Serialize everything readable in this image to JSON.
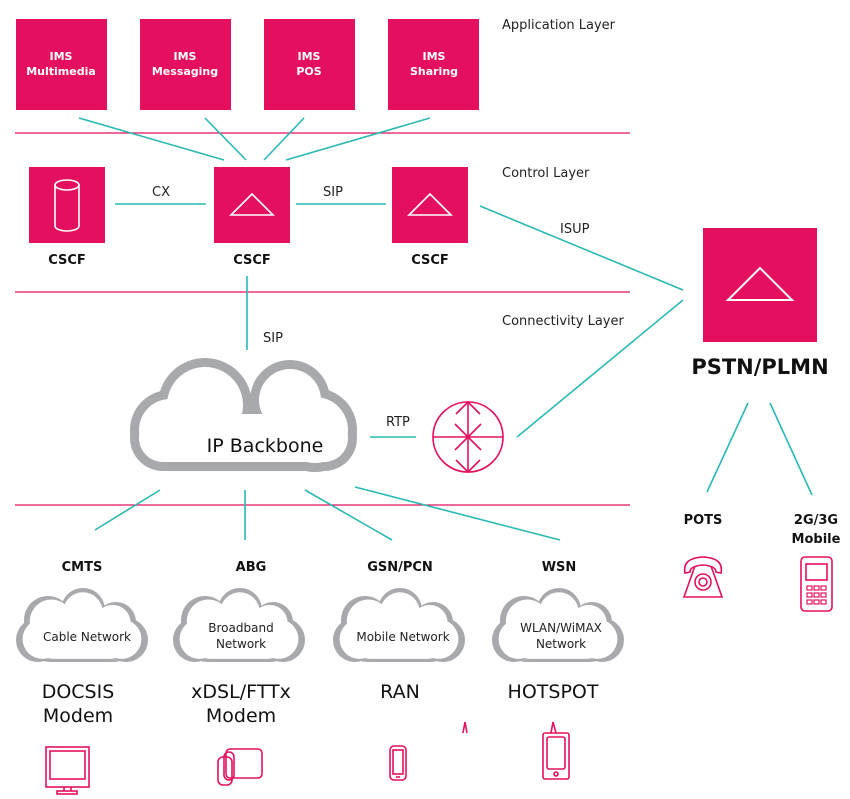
{
  "layers": {
    "application": "Application Layer",
    "control": "Control Layer",
    "connectivity": "Connectivity Layer"
  },
  "ims": [
    {
      "line1": "IMS",
      "line2": "Multimedia"
    },
    {
      "line1": "IMS",
      "line2": "Messaging"
    },
    {
      "line1": "IMS",
      "line2": "POS"
    },
    {
      "line1": "IMS",
      "line2": "Sharing"
    }
  ],
  "cscf": [
    "CSCF",
    "CSCF",
    "CSCF"
  ],
  "links": {
    "cx": "CX",
    "sip_h": "SIP",
    "isup": "ISUP",
    "sip_v": "SIP",
    "rtp": "RTP"
  },
  "pstn": "PSTN/PLMN",
  "backbone": "IP Backbone",
  "pstn_children": [
    {
      "line1": "POTS",
      "line2": ""
    },
    {
      "line1": "2G/3G",
      "line2": "Mobile"
    }
  ],
  "access": [
    {
      "gateway": "CMTS",
      "net1": "Cable Network",
      "net2": "",
      "dev1": "DOCSIS",
      "dev2": "Modem"
    },
    {
      "gateway": "ABG",
      "net1": "Broadband",
      "net2": "Network",
      "dev1": "xDSL/FTTx",
      "dev2": "Modem"
    },
    {
      "gateway": "GSN/PCN",
      "net1": "Mobile Network",
      "net2": "",
      "dev1": "RAN",
      "dev2": ""
    },
    {
      "gateway": "WSN",
      "net1": "WLAN/WiMAX",
      "net2": "Network",
      "dev1": "HOTSPOT",
      "dev2": ""
    }
  ],
  "colors": {
    "accent": "#E4105F",
    "link": "#2BB9B3",
    "cloud": "#A7A9AC"
  }
}
